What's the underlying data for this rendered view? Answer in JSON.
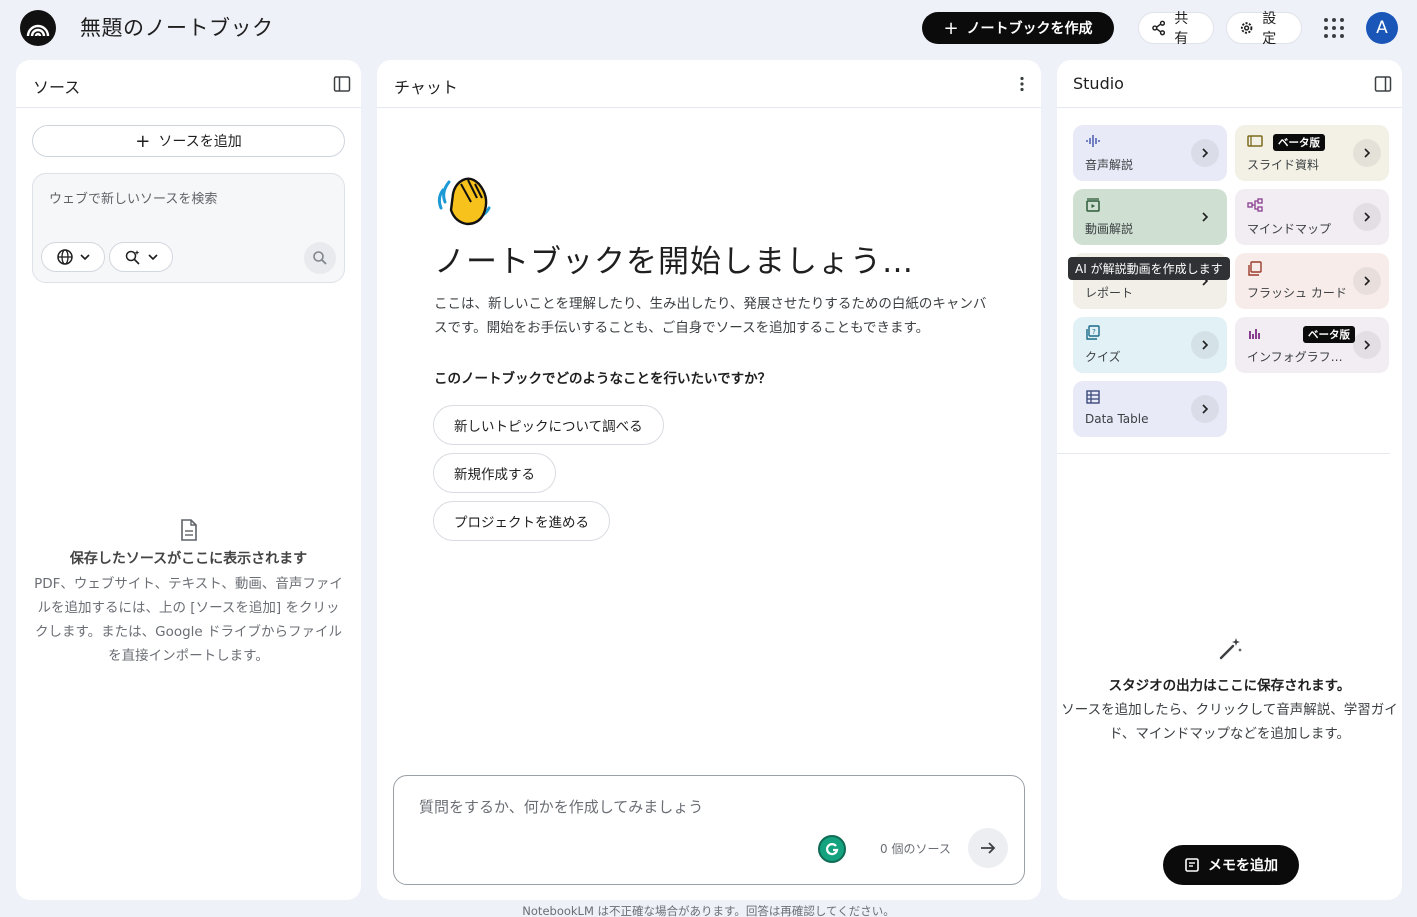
{
  "header": {
    "title": "無題のノートブック",
    "create_label": "ノートブックを作成",
    "share_label": "共有",
    "settings_label": "設定",
    "avatar_initial": "A"
  },
  "sources": {
    "title": "ソース",
    "add_label": "ソースを追加",
    "search_placeholder": "ウェブで新しいソースを検索",
    "empty_title": "保存したソースがここに表示されます",
    "empty_body": "PDF、ウェブサイト、テキスト、動画、音声ファイルを追加するには、上の [ソースを追加] をクリックします。または、Google ドライブからファイルを直接インポートします。"
  },
  "chat": {
    "title": "チャット",
    "heading": "ノートブックを開始しましょう…",
    "description": "ここは、新しいことを理解したり、生み出したり、発展させたりするための白紙のキャンバスです。開始をお手伝いすることも、ご自身でソースを追加することもできます。",
    "question": "このノートブックでどのようなことを行いたいですか？",
    "suggestions": [
      "新しいトピックについて調べる",
      "新規作成する",
      "プロジェクトを進める"
    ],
    "input_placeholder": "質問をするか、何かを作成してみましょう",
    "source_count": "0 個のソース"
  },
  "studio": {
    "title": "Studio",
    "tiles": [
      {
        "label": "音声解説",
        "icon": "audio-wave-icon",
        "color": "#e8ebf7"
      },
      {
        "label": "スライド資料",
        "icon": "slides-icon",
        "color": "#f3f1e6",
        "badge": "ベータ版"
      },
      {
        "label": "動画解説",
        "icon": "video-icon",
        "color": "#e2ece4"
      },
      {
        "label": "マインドマップ",
        "icon": "mindmap-icon",
        "color": "#f2ecf3"
      },
      {
        "label": "レポート",
        "icon": "report-icon",
        "color": "#f1efe7"
      },
      {
        "label": "フラッシュ カード",
        "icon": "flashcard-icon",
        "color": "#f7ecea"
      },
      {
        "label": "クイズ",
        "icon": "quiz-icon",
        "color": "#e2f1f6"
      },
      {
        "label": "インフォグラフ…",
        "icon": "infographic-icon",
        "color": "#f2ecf3",
        "badge": "ベータ版"
      },
      {
        "label": "Data Table",
        "icon": "table-icon",
        "color": "#e8ebf7"
      }
    ],
    "tooltip": "AI が解説動画を作成します",
    "empty_title": "スタジオの出力はここに保存されます。",
    "empty_body": "ソースを追加したら、クリックして音声解説、学習ガイド、マインドマップなどを追加します。",
    "memo_label": "メモを追加"
  },
  "footer": "NotebookLM は不正確な場合があります。回答は再確認してください。"
}
